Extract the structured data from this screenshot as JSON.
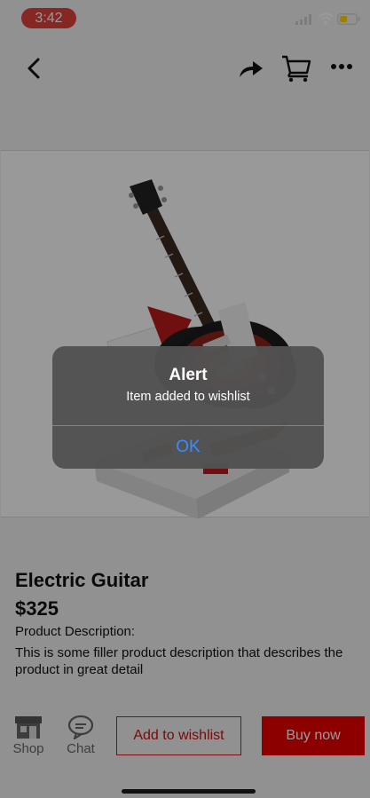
{
  "status_bar": {
    "time": "3:42"
  },
  "nav": {
    "back_icon": "chevron-left-icon",
    "share_icon": "share-arrow-icon",
    "cart_icon": "cart-icon",
    "more_icon": "ellipsis-icon"
  },
  "product": {
    "title": "Electric Guitar",
    "price": "$325",
    "description_label": "Product Description:",
    "description": "This is some filler product description that describes the product in great detail"
  },
  "bottom_bar": {
    "shop_label": "Shop",
    "chat_label": "Chat",
    "wishlist_label": "Add to wishlist",
    "buy_label": "Buy now"
  },
  "alert": {
    "title": "Alert",
    "message": "Item added to wishlist",
    "ok_label": "OK"
  },
  "colors": {
    "accent_red": "#ec0000",
    "time_pill": "#e0413b",
    "alert_button": "#3a8cff"
  }
}
